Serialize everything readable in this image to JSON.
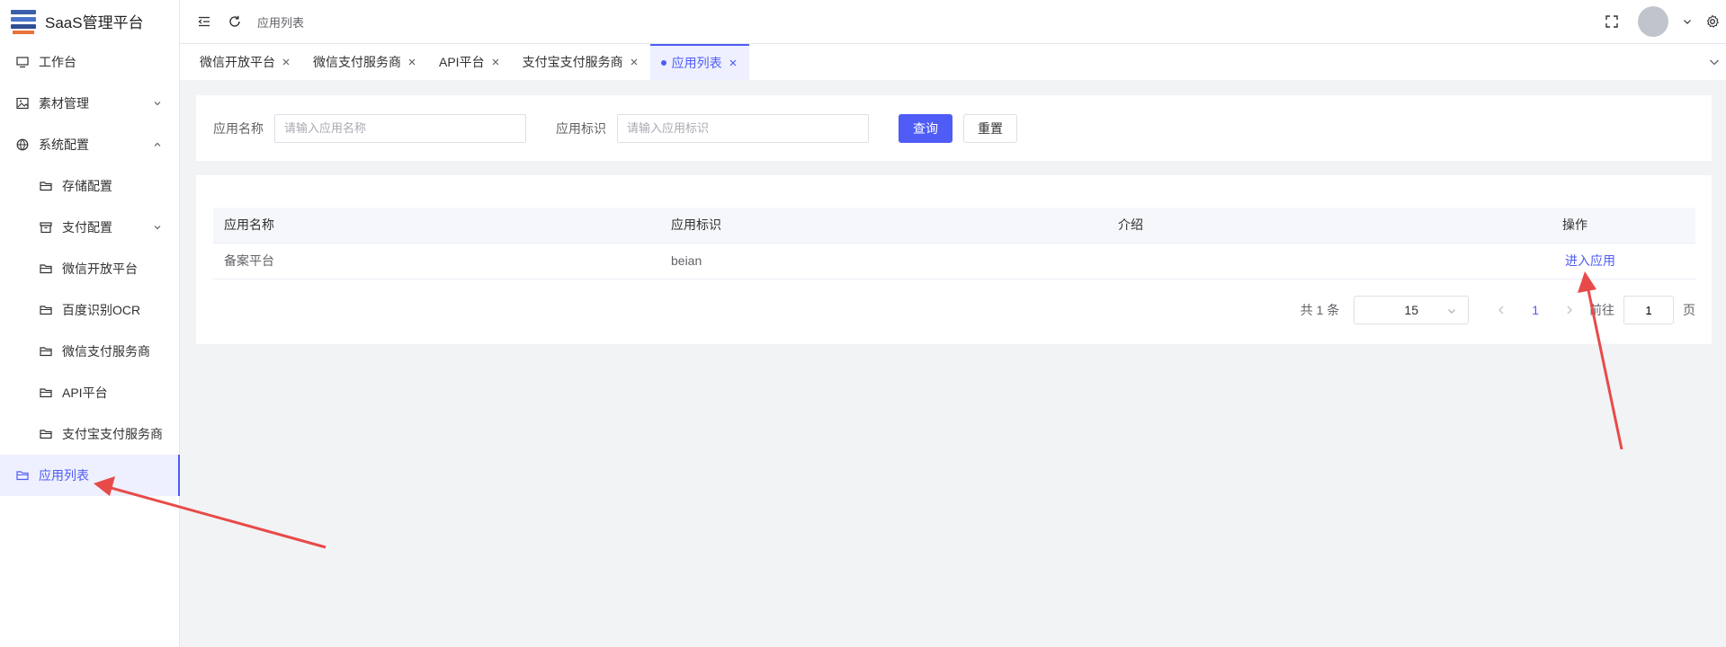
{
  "app": {
    "title": "SaaS管理平台"
  },
  "sidebar": {
    "items": [
      {
        "label": "工作台",
        "icon": "monitor-icon"
      },
      {
        "label": "素材管理",
        "icon": "image-icon"
      },
      {
        "label": "系统配置",
        "icon": "globe-icon"
      },
      {
        "label": "存储配置",
        "icon": "folder-icon"
      },
      {
        "label": "支付配置",
        "icon": "archive-icon"
      },
      {
        "label": "微信开放平台",
        "icon": "folder-icon"
      },
      {
        "label": "百度识别OCR",
        "icon": "folder-icon"
      },
      {
        "label": "微信支付服务商",
        "icon": "folder-icon"
      },
      {
        "label": "API平台",
        "icon": "folder-icon"
      },
      {
        "label": "支付宝支付服务商",
        "icon": "folder-icon"
      },
      {
        "label": "应用列表",
        "icon": "folder-icon",
        "active": true
      }
    ]
  },
  "header": {
    "breadcrumb": "应用列表"
  },
  "tabs": [
    {
      "label": "微信开放平台"
    },
    {
      "label": "微信支付服务商"
    },
    {
      "label": "API平台"
    },
    {
      "label": "支付宝支付服务商"
    },
    {
      "label": "应用列表",
      "active": true
    }
  ],
  "search": {
    "name_label": "应用名称",
    "name_placeholder": "请输入应用名称",
    "key_label": "应用标识",
    "key_placeholder": "请输入应用标识",
    "query_button": "查询",
    "reset_button": "重置"
  },
  "table": {
    "columns": [
      "应用名称",
      "应用标识",
      "介绍",
      "操作"
    ],
    "rows": [
      {
        "name": "备案平台",
        "key": "beian",
        "intro": "",
        "action": "进入应用"
      }
    ]
  },
  "pagination": {
    "total_text": "共 1 条",
    "page_size": "15",
    "current_page": "1",
    "goto_prefix": "前往",
    "goto_value": "1",
    "goto_suffix": "页"
  },
  "colors": {
    "accent": "#4f5cf6",
    "annotation": "#e84a4a"
  }
}
